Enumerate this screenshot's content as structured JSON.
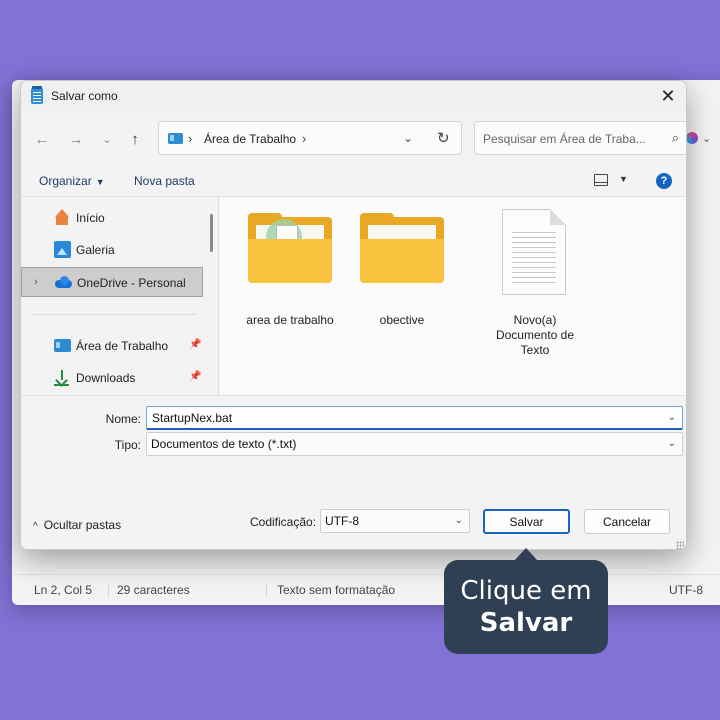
{
  "dialog": {
    "title": "Salvar como",
    "close_icon": "close-icon"
  },
  "navigation": {
    "back_icon": "arrow-left-icon",
    "forward_icon": "arrow-right-icon",
    "recent_icon": "chevron-down-icon",
    "up_icon": "arrow-up-icon",
    "address": {
      "location": "Área de Trabalho",
      "icon": "desktop-icon"
    },
    "search": {
      "placeholder": "Pesquisar em Área de Traba...",
      "icon": "search-icon"
    }
  },
  "commandbar": {
    "organizar_label": "Organizar",
    "nova_pasta_label": "Nova pasta",
    "help_label": "?"
  },
  "sidebar": {
    "items": [
      {
        "label": "Início",
        "icon": "home-icon"
      },
      {
        "label": "Galeria",
        "icon": "gallery-icon"
      },
      {
        "label": "OneDrive - Personal",
        "icon": "onedrive-icon",
        "selected": true
      },
      {
        "label": "Área de Trabalho",
        "icon": "desktop-icon",
        "pinned": true
      },
      {
        "label": "Downloads",
        "icon": "download-icon",
        "pinned": true
      }
    ]
  },
  "files": [
    {
      "name": "area de trabalho",
      "type": "folder"
    },
    {
      "name": "obective",
      "type": "folder"
    },
    {
      "name": "Novo(a) Documento de Texto",
      "type": "text-document"
    }
  ],
  "form": {
    "nome_label": "Nome:",
    "nome_value": "StartupNex.bat",
    "tipo_label": "Tipo:",
    "tipo_value": "Documentos de texto (*.txt)"
  },
  "footer": {
    "ocultar_label": "Ocultar pastas",
    "codificacao_label": "Codificação:",
    "codificacao_value": "UTF-8",
    "salvar_label": "Salvar",
    "cancelar_label": "Cancelar"
  },
  "notepad_status": {
    "position": "Ln 2, Col 5",
    "chars": "29 caracteres",
    "format": "Texto sem formatação",
    "encoding": "UTF-8"
  },
  "callout": {
    "line1": "Clique em",
    "line2": "Salvar"
  },
  "colors": {
    "background": "#8272d6",
    "accent": "#1b62c4",
    "callout": "#2f3f54"
  }
}
